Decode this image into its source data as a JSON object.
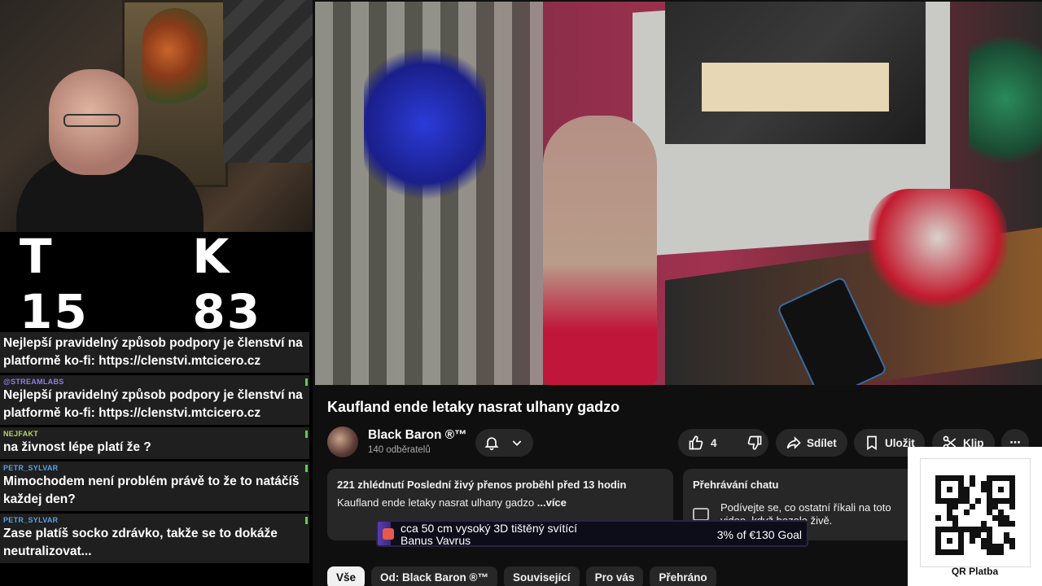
{
  "overlay": {
    "counter": {
      "t": "T 15",
      "k": "K 83"
    },
    "chat": [
      {
        "author": "",
        "text": "Nejlepší pravidelný způsob podpory je členství na platformě ko-fi: https://clenstvi.mtcicero.cz"
      },
      {
        "author": "@STREAMLABS",
        "text": "Nejlepší pravidelný způsob podpory je členství na platformě ko-fi: https://clenstvi.mtcicero.cz"
      },
      {
        "author": "NEJFAKT",
        "text": "na živnost lépe platí že ?"
      },
      {
        "author": "PETR_SYLVAR",
        "text": "Mimochodem není problém právě to že to natáčíš každej den?"
      },
      {
        "author": "PETR_SYLVAR",
        "text": "Zase platíš socko zdrávko, takže se to dokáže neutralizovat..."
      }
    ],
    "goal": {
      "line1": "cca 50 cm vysoký 3D tištěný svítící",
      "line2": "Banus Vavrus",
      "progress": "3% of €130 Goal",
      "fraction": 0.03
    },
    "qr_label": "QR Platba"
  },
  "video": {
    "title": "Kaufland ende letaky nasrat ulhany gadzo"
  },
  "channel": {
    "name": "Black Baron ®™",
    "subscribers": "140 odběratelů"
  },
  "actions": {
    "likes": "4",
    "share": "Sdílet",
    "save": "Uložit",
    "clip": "Klip",
    "more": "⋯"
  },
  "description": {
    "meta": "221 zhlédnutí  Poslední živý přenos proběhl před 13 hodin",
    "body": "Kaufland ende letaky nasrat ulhany gadzo",
    "more": "...více"
  },
  "chat_replay": {
    "title": "Přehrávání chatu",
    "text": "Podívejte se, co ostatní říkali na toto video, když bezelo živě."
  },
  "chips": [
    "Vše",
    "Od: Black Baron ®™",
    "Související",
    "Pro vás",
    "Přehráno"
  ],
  "colors": {
    "page_bg": "#0f0f0f",
    "button_bg": "#272727",
    "goal_fill": "#5b3bb0"
  }
}
